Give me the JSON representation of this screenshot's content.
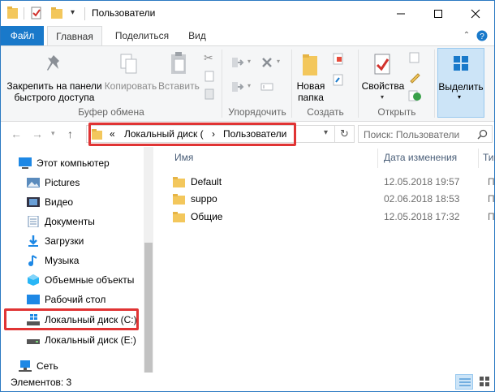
{
  "window": {
    "title": "Пользователи"
  },
  "tabs": [
    {
      "label": "Файл"
    },
    {
      "label": "Главная"
    },
    {
      "label": "Поделиться"
    },
    {
      "label": "Вид"
    }
  ],
  "ribbon": {
    "pin": {
      "line1": "Закрепить на панели",
      "line2": "быстрого доступа"
    },
    "copy": "Копировать",
    "paste": "Вставить",
    "clipboard_group": "Буфер обмена",
    "organize_group": "Упорядочить",
    "new_folder": {
      "line1": "Новая",
      "line2": "папка"
    },
    "create_group": "Создать",
    "properties": "Свойства",
    "open_group": "Открыть",
    "select": "Выделить"
  },
  "address": {
    "overflow": "«",
    "crumb1": "Локальный диск (",
    "sep": "›",
    "crumb2": "Пользователи"
  },
  "search": {
    "placeholder": "Поиск: Пользователи"
  },
  "nav": {
    "this_pc": "Этот компьютер",
    "items": [
      {
        "label": "Pictures",
        "icon": "pictures-icon"
      },
      {
        "label": "Видео",
        "icon": "video-icon"
      },
      {
        "label": "Документы",
        "icon": "documents-icon"
      },
      {
        "label": "Загрузки",
        "icon": "downloads-icon"
      },
      {
        "label": "Музыка",
        "icon": "music-icon"
      },
      {
        "label": "Объемные объекты",
        "icon": "3d-objects-icon"
      },
      {
        "label": "Рабочий стол",
        "icon": "desktop-icon"
      },
      {
        "label": "Локальный диск (C:)",
        "icon": "drive-icon"
      },
      {
        "label": "Локальный диск (E:)",
        "icon": "drive-icon"
      }
    ],
    "network": "Сеть"
  },
  "columns": {
    "name": "Имя",
    "date": "Дата изменения",
    "type": "Тип"
  },
  "files": [
    {
      "name": "Default",
      "date": "12.05.2018 19:57",
      "type": "Па"
    },
    {
      "name": "suppo",
      "date": "02.06.2018 18:53",
      "type": "Па"
    },
    {
      "name": "Общие",
      "date": "12.05.2018 17:32",
      "type": "Па"
    }
  ],
  "status": {
    "items": "Элементов: 3"
  }
}
